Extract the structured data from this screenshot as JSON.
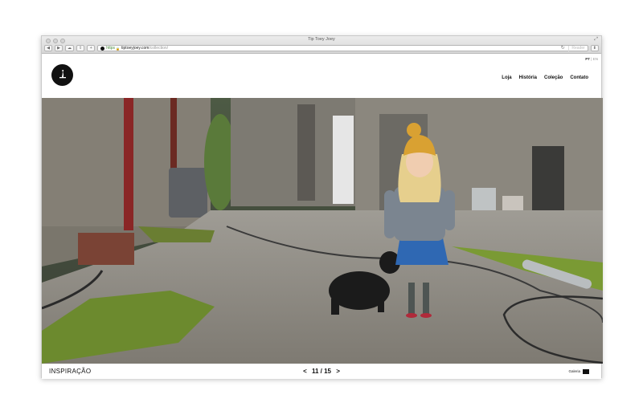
{
  "browser": {
    "title": "Tip Toey Joey",
    "url_host": "tiptoeyjoey.com",
    "url_path": "/collection/",
    "url_scheme": "https",
    "reader_label": "Reader"
  },
  "header": {
    "lang_active": "PT",
    "lang_sep": "|",
    "lang_other": "EN",
    "nav": [
      "Loja",
      "História",
      "Coleção",
      "Contato"
    ]
  },
  "footer": {
    "section_label": "INSPIRAÇÃO",
    "prev": "<",
    "page": "11 / 15",
    "next": ">",
    "gallery_label": "Galeria"
  },
  "colors": {
    "accent": "#111111",
    "hat": "#d9a132",
    "dress": "#2f68b3"
  },
  "icons": [
    "back-icon",
    "forward-icon",
    "cloud-icon",
    "share-icon",
    "add-tab-icon",
    "lock-icon",
    "refresh-icon",
    "download-icon",
    "fullscreen-icon",
    "logo-icon",
    "grid-icon"
  ]
}
